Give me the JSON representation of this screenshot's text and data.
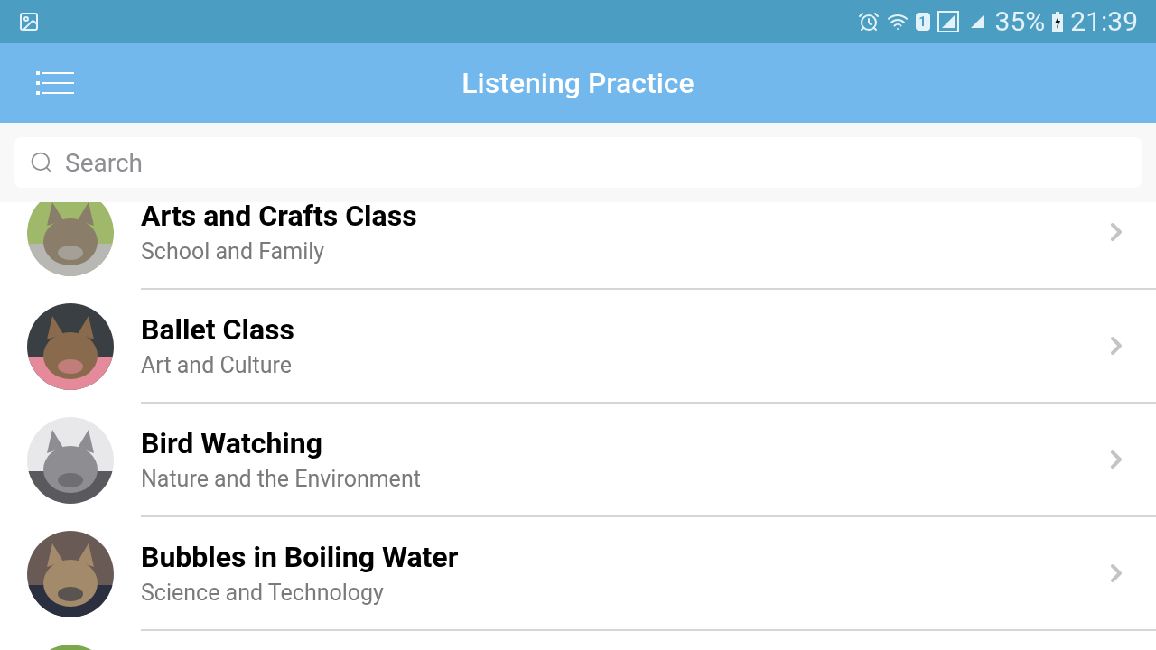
{
  "status_bar": {
    "sim": "1",
    "battery": "35%",
    "time": "21:39"
  },
  "header": {
    "title": "Listening Practice"
  },
  "search": {
    "placeholder": "Search"
  },
  "list": {
    "rows": [
      {
        "title": "Arts and Crafts Class",
        "subtitle": "School and Family"
      },
      {
        "title": "Ballet Class",
        "subtitle": "Art and Culture"
      },
      {
        "title": "Bird Watching",
        "subtitle": "Nature and the Environment"
      },
      {
        "title": "Bubbles in Boiling Water",
        "subtitle": "Science and Technology"
      }
    ]
  }
}
